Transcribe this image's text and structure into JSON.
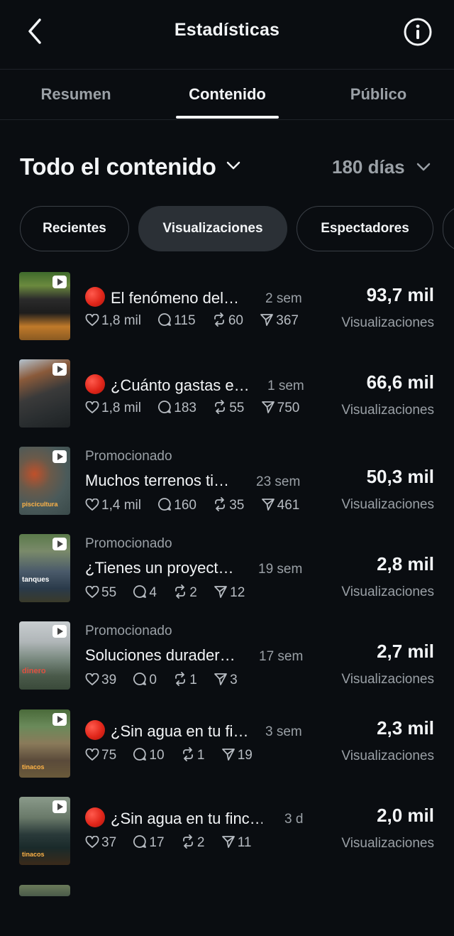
{
  "header": {
    "title": "Estadísticas"
  },
  "tabs": [
    {
      "label": "Resumen",
      "active": false
    },
    {
      "label": "Contenido",
      "active": true
    },
    {
      "label": "Público",
      "active": false
    }
  ],
  "section": {
    "title": "Todo el contenido",
    "period": "180 días"
  },
  "chips": [
    {
      "label": "Recientes",
      "selected": false
    },
    {
      "label": "Visualizaciones",
      "selected": true
    },
    {
      "label": "Espectadores",
      "selected": false
    }
  ],
  "posts": [
    {
      "promoted": "",
      "live_dot": true,
      "title": "El fenómeno del…",
      "age": "2 sem",
      "likes": "1,8 mil",
      "comments": "115",
      "reposts": "60",
      "shares": "367",
      "views": "93,7 mil",
      "views_label": "Visualizaciones"
    },
    {
      "promoted": "",
      "live_dot": true,
      "title": "¿Cuánto gastas e…",
      "age": "1 sem",
      "likes": "1,8 mil",
      "comments": "183",
      "reposts": "55",
      "shares": "750",
      "views": "66,6 mil",
      "views_label": "Visualizaciones"
    },
    {
      "promoted": "Promocionado",
      "live_dot": false,
      "title": "Muchos terrenos ti…",
      "age": "23 sem",
      "likes": "1,4 mil",
      "comments": "160",
      "reposts": "35",
      "shares": "461",
      "views": "50,3 mil",
      "views_label": "Visualizaciones"
    },
    {
      "promoted": "Promocionado",
      "live_dot": false,
      "title": "¿Tienes un proyect…",
      "age": "19 sem",
      "likes": "55",
      "comments": "4",
      "reposts": "2",
      "shares": "12",
      "views": "2,8 mil",
      "views_label": "Visualizaciones"
    },
    {
      "promoted": "Promocionado",
      "live_dot": false,
      "title": "Soluciones durader…",
      "age": "17 sem",
      "likes": "39",
      "comments": "0",
      "reposts": "1",
      "shares": "3",
      "views": "2,7 mil",
      "views_label": "Visualizaciones"
    },
    {
      "promoted": "",
      "live_dot": true,
      "title": "¿Sin agua en tu fi…",
      "age": "3 sem",
      "likes": "75",
      "comments": "10",
      "reposts": "1",
      "shares": "19",
      "views": "2,3 mil",
      "views_label": "Visualizaciones"
    },
    {
      "promoted": "",
      "live_dot": true,
      "title": "¿Sin agua en tu finc…",
      "age": "3 d",
      "likes": "37",
      "comments": "17",
      "reposts": "2",
      "shares": "11",
      "views": "2,0 mil",
      "views_label": "Visualizaciones"
    }
  ],
  "thumb_captions": [
    "",
    "",
    "piscicultura",
    "tanques",
    "dinero",
    "tinacos",
    "tinacos"
  ],
  "icons": {
    "back": "chevron-left-icon",
    "info": "info-icon",
    "like": "heart-icon",
    "comment": "comment-icon",
    "repost": "repost-icon",
    "share": "share-icon",
    "dropdown": "chevron-down-icon",
    "play": "play-icon"
  },
  "colors": {
    "background": "#0a0d11",
    "text": "#f3f5f7",
    "muted": "#9aa0a6",
    "chip_selected": "#2b3036",
    "live_dot": "#e0261a"
  }
}
